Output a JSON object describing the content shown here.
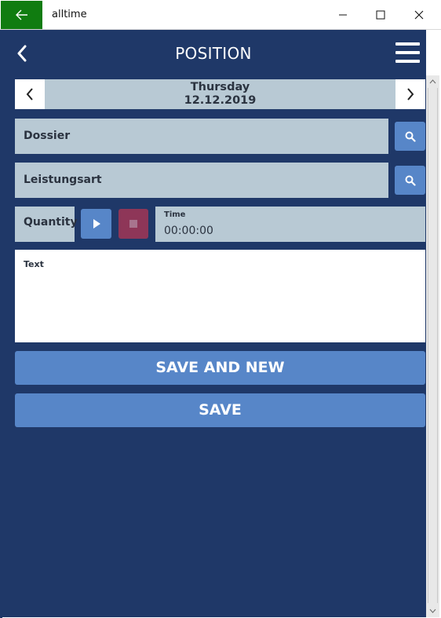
{
  "window": {
    "title": "alltime",
    "back_icon": "arrow-left-icon",
    "minimize_icon": "minimize-icon",
    "maximize_icon": "maximize-icon",
    "close_icon": "close-icon",
    "accent": "#107c10"
  },
  "header": {
    "title": "POSITION",
    "back_icon": "chevron-left-icon",
    "menu_icon": "hamburger-menu-icon",
    "background": "#1f3868"
  },
  "date": {
    "weekday": "Thursday",
    "date": "12.12.2019",
    "prev_icon": "chevron-left-icon",
    "next_icon": "chevron-right-icon"
  },
  "form": {
    "dossier_label": "Dossier",
    "leistungsart_label": "Leistungsart",
    "search_icon": "search-icon",
    "quantity_label": "Quantity",
    "play_icon": "play-icon",
    "stop_icon": "stop-icon",
    "time_label": "Time",
    "time_value": "00:00:00",
    "text_label": "Text",
    "text_value": ""
  },
  "actions": {
    "save_and_new": "SAVE AND NEW",
    "save": "SAVE",
    "button_color": "#5786c8"
  }
}
